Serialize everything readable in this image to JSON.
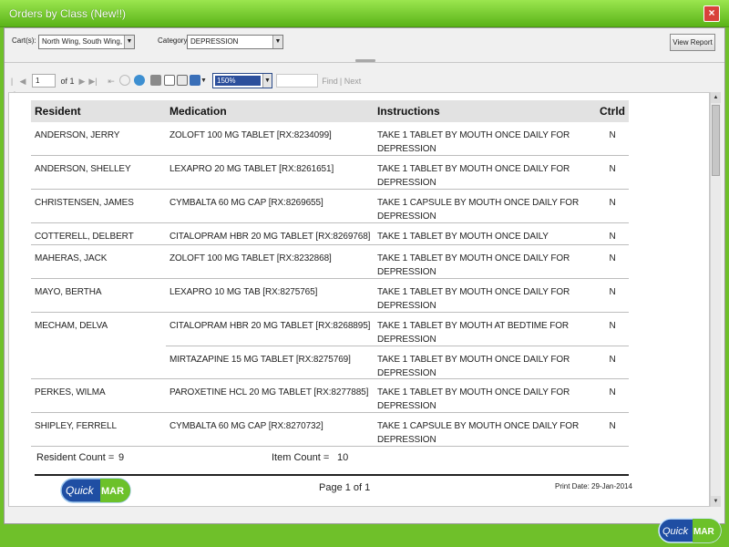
{
  "window": {
    "title": "Orders by Class  (New!!)",
    "close_label": "×"
  },
  "filters": {
    "carts_label": "Cart(s):",
    "carts_value": "North Wing, South Wing, West",
    "category_label": "Category",
    "category_value": "DEPRESSION",
    "view_report_label": "View Report"
  },
  "toolbar": {
    "page_value": "1",
    "page_of": "of 1",
    "zoom_value": "150%",
    "find_label": "Find",
    "next_label": "Next",
    "separator": "|"
  },
  "report": {
    "columns": [
      "Resident",
      "Medication",
      "Instructions",
      "Ctrld"
    ],
    "rows": [
      {
        "resident": "ANDERSON, JERRY",
        "orders": [
          {
            "medication": "ZOLOFT 100 MG TABLET [RX:8234099]",
            "instructions": "TAKE 1 TABLET BY MOUTH ONCE DAILY FOR DEPRESSION",
            "ctrld": "N"
          }
        ]
      },
      {
        "resident": "ANDERSON, SHELLEY",
        "orders": [
          {
            "medication": "LEXAPRO 20 MG TABLET [RX:8261651]",
            "instructions": "TAKE 1 TABLET BY MOUTH ONCE DAILY FOR DEPRESSION",
            "ctrld": "N"
          }
        ]
      },
      {
        "resident": "CHRISTENSEN, JAMES",
        "orders": [
          {
            "medication": "CYMBALTA 60 MG CAP [RX:8269655]",
            "instructions": "TAKE 1 CAPSULE BY MOUTH ONCE DAILY FOR DEPRESSION",
            "ctrld": "N"
          }
        ]
      },
      {
        "resident": "COTTERELL, DELBERT",
        "orders": [
          {
            "medication": "CITALOPRAM HBR 20 MG TABLET [RX:8269768]",
            "instructions": "TAKE 1 TABLET BY MOUTH ONCE DAILY",
            "ctrld": "N"
          }
        ]
      },
      {
        "resident": "MAHERAS, JACK",
        "orders": [
          {
            "medication": "ZOLOFT 100 MG TABLET [RX:8232868]",
            "instructions": "TAKE 1 TABLET BY MOUTH ONCE DAILY FOR DEPRESSION",
            "ctrld": "N"
          }
        ]
      },
      {
        "resident": "MAYO, BERTHA",
        "orders": [
          {
            "medication": "LEXAPRO 10 MG TAB [RX:8275765]",
            "instructions": "TAKE 1 TABLET BY MOUTH ONCE DAILY FOR DEPRESSION",
            "ctrld": "N"
          }
        ]
      },
      {
        "resident": "MECHAM, DELVA",
        "orders": [
          {
            "medication": "CITALOPRAM HBR 20 MG TABLET [RX:8268895]",
            "instructions": "TAKE 1 TABLET BY MOUTH AT BEDTIME FOR DEPRESSION",
            "ctrld": "N"
          },
          {
            "medication": "MIRTAZAPINE 15 MG TABLET [RX:8275769]",
            "instructions": "TAKE 1 TABLET BY MOUTH ONCE DAILY FOR DEPRESSION",
            "ctrld": "N"
          }
        ]
      },
      {
        "resident": "PERKES, WILMA",
        "orders": [
          {
            "medication": "PAROXETINE HCL 20 MG TABLET [RX:8277885]",
            "instructions": "TAKE 1 TABLET BY MOUTH ONCE DAILY FOR DEPRESSION",
            "ctrld": "N"
          }
        ]
      },
      {
        "resident": "SHIPLEY, FERRELL",
        "orders": [
          {
            "medication": "CYMBALTA 60 MG CAP [RX:8270732]",
            "instructions": "TAKE 1 CAPSULE BY MOUTH ONCE DAILY FOR DEPRESSION",
            "ctrld": "N"
          }
        ]
      }
    ],
    "resident_count_label": "Resident Count =",
    "resident_count": "9",
    "item_count_label": "Item Count =",
    "item_count": "10",
    "page_label": "Page 1 of 1",
    "print_date": "Print Date: 29-Jan-2014"
  },
  "brand": {
    "logo_quick": "Quick",
    "logo_mar": "MAR"
  },
  "colors": {
    "chrome": "#6fc02a",
    "logo_blue": "#1f4ea3",
    "logo_green": "#6cc12a"
  }
}
